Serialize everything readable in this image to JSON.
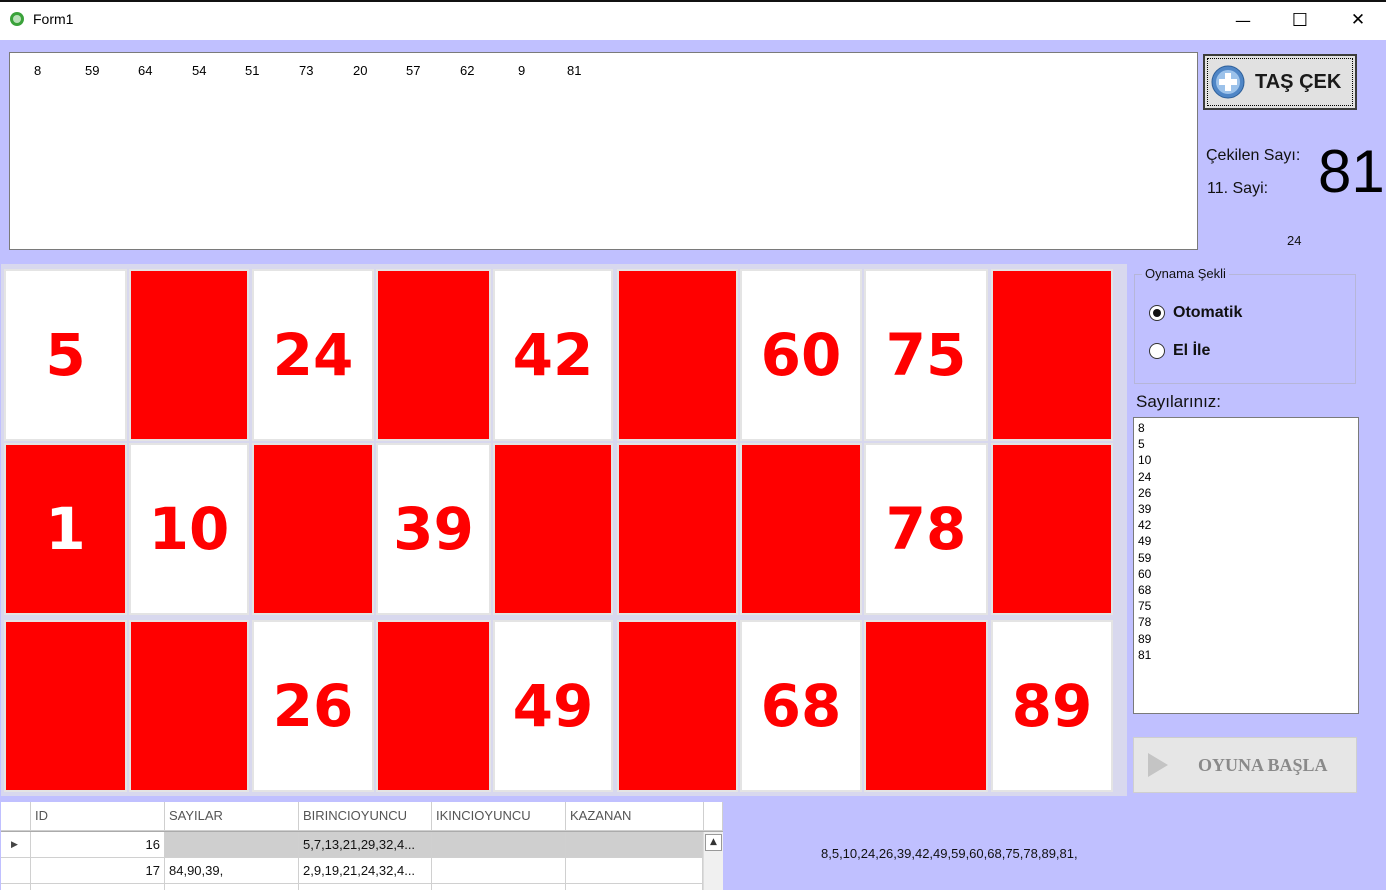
{
  "window": {
    "title": "Form1",
    "minimize": "—",
    "maximize": "☐",
    "close": "✕"
  },
  "drawn_numbers": [
    "8",
    "59",
    "64",
    "54",
    "51",
    "73",
    "20",
    "57",
    "62",
    "9",
    "81"
  ],
  "draw_button": {
    "label": "TAŞ ÇEK",
    "icon": "plus-circle-icon"
  },
  "drawn_info": {
    "label": "Çekilen Sayı:",
    "value": "81",
    "count_label": "11. Sayi:",
    "extra_value": "24"
  },
  "card": {
    "rows": [
      [
        {
          "n": "5",
          "red": false
        },
        {
          "n": "",
          "red": true
        },
        {
          "n": "24",
          "red": false
        },
        {
          "n": "",
          "red": true
        },
        {
          "n": "42",
          "red": false
        },
        {
          "n": "",
          "red": true
        },
        {
          "n": "60",
          "red": false
        },
        {
          "n": "75",
          "red": false
        },
        {
          "n": "",
          "red": true
        }
      ],
      [
        {
          "n": "1",
          "red": true
        },
        {
          "n": "10",
          "red": false
        },
        {
          "n": "",
          "red": true
        },
        {
          "n": "39",
          "red": false
        },
        {
          "n": "",
          "red": true
        },
        {
          "n": "",
          "red": true
        },
        {
          "n": "",
          "red": true
        },
        {
          "n": "78",
          "red": false
        },
        {
          "n": "",
          "red": true
        }
      ],
      [
        {
          "n": "",
          "red": true
        },
        {
          "n": "",
          "red": true
        },
        {
          "n": "26",
          "red": false
        },
        {
          "n": "",
          "red": true
        },
        {
          "n": "49",
          "red": false
        },
        {
          "n": "",
          "red": true
        },
        {
          "n": "68",
          "red": false
        },
        {
          "n": "",
          "red": true
        },
        {
          "n": "89",
          "red": false
        }
      ]
    ]
  },
  "play_mode": {
    "legend": "Oynama Şekli",
    "options": [
      {
        "label": "Otomatik",
        "checked": true
      },
      {
        "label": "El İle",
        "checked": false
      }
    ]
  },
  "your_numbers": {
    "label": "Sayılarınız:",
    "items": [
      "8",
      "5",
      "10",
      "24",
      "26",
      "39",
      "42",
      "49",
      "59",
      "60",
      "68",
      "75",
      "78",
      "89",
      "81"
    ]
  },
  "start_button": {
    "label": "OYUNA BAŞLA",
    "icon": "play-icon"
  },
  "table": {
    "columns": [
      "ID",
      "SAYILAR",
      "BIRINCIOYUNCU",
      "IKINCIOYUNCU",
      "KAZANAN"
    ],
    "rows": [
      {
        "id": "16",
        "sayilar": "",
        "birinci": "5,7,13,21,29,32,4...",
        "ikinci": "",
        "kazanan": "",
        "selected": true
      },
      {
        "id": "17",
        "sayilar": "84,90,39,",
        "birinci": "2,9,19,21,24,32,4...",
        "ikinci": "",
        "kazanan": "",
        "selected": false
      }
    ]
  },
  "summary_text": "8,5,10,24,26,39,42,49,59,60,68,75,78,89,81,",
  "colors": {
    "background": "#c0c0ff",
    "marked": "#ff0000",
    "number_text": "#ff0000"
  }
}
